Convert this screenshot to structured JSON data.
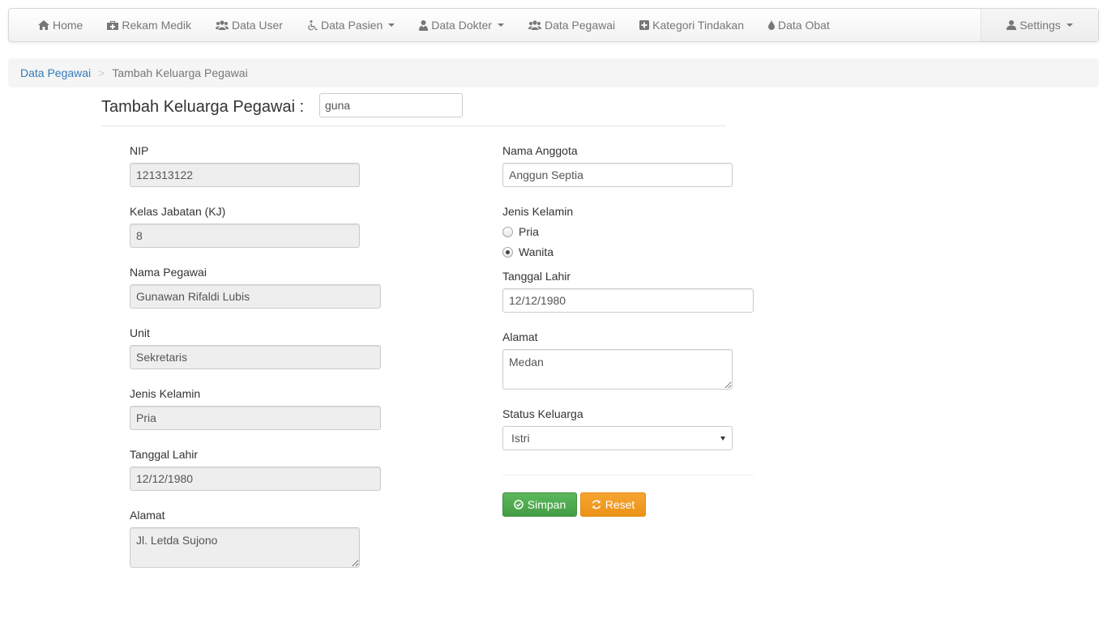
{
  "nav": {
    "items": [
      {
        "label": "Home",
        "icon": "home-icon"
      },
      {
        "label": "Rekam Medik",
        "icon": "medkit-icon"
      },
      {
        "label": "Data User",
        "icon": "users-icon"
      },
      {
        "label": "Data Pasien",
        "icon": "wheelchair-icon",
        "dropdown": true
      },
      {
        "label": "Data Dokter",
        "icon": "user-md-icon",
        "dropdown": true
      },
      {
        "label": "Data Pegawai",
        "icon": "users-icon"
      },
      {
        "label": "Kategori Tindakan",
        "icon": "plus-square-icon"
      },
      {
        "label": "Data Obat",
        "icon": "tint-icon"
      }
    ],
    "settings_label": "Settings"
  },
  "breadcrumb": {
    "link": "Data Pegawai",
    "separator": ">",
    "active": "Tambah Keluarga Pegawai"
  },
  "heading": {
    "title": "Tambah Keluarga Pegawai :",
    "search_value": "guna"
  },
  "employee": {
    "nip_label": "NIP",
    "nip_value": "121313122",
    "kelas_label": "Kelas Jabatan (KJ)",
    "kelas_value": "8",
    "nama_label": "Nama Pegawai",
    "nama_value": "Gunawan Rifaldi Lubis",
    "unit_label": "Unit",
    "unit_value": "Sekretaris",
    "jk_label": "Jenis Kelamin",
    "jk_value": "Pria",
    "tgl_label": "Tanggal Lahir",
    "tgl_value": "12/12/1980",
    "alamat_label": "Alamat",
    "alamat_value": "Jl. Letda Sujono"
  },
  "family": {
    "nama_label": "Nama Anggota",
    "nama_value": "Anggun Septia",
    "jk_label": "Jenis Kelamin",
    "jk_options": [
      "Pria",
      "Wanita"
    ],
    "jk_selected": "Wanita",
    "tgl_label": "Tanggal Lahir",
    "tgl_value": "12/12/1980",
    "alamat_label": "Alamat",
    "alamat_value": "Medan",
    "status_label": "Status Keluarga",
    "status_value": "Istri"
  },
  "buttons": {
    "save_label": "Simpan",
    "reset_label": "Reset"
  },
  "colors": {
    "link": "#337ab7",
    "save": "#5cb85c",
    "reset": "#f0ad4e"
  }
}
